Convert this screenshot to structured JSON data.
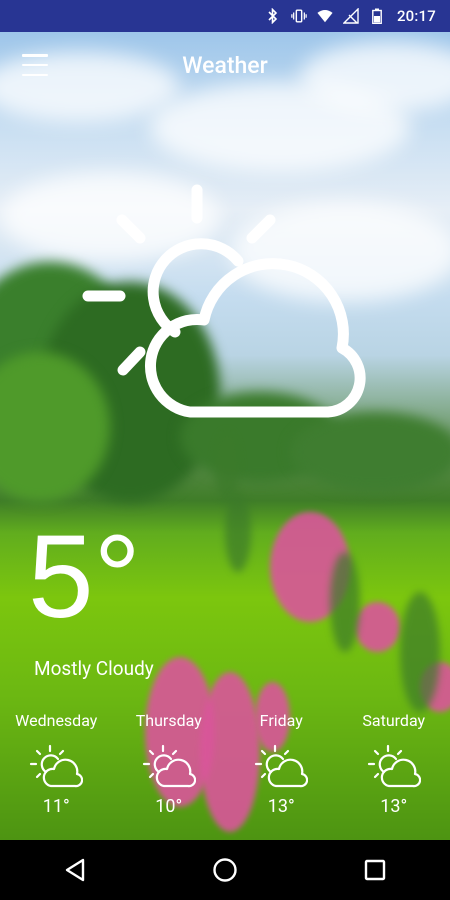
{
  "status_bar": {
    "time": "20:17",
    "icons": [
      "bluetooth-icon",
      "vibrate-icon",
      "wifi-icon",
      "no-signal-icon",
      "battery-icon"
    ]
  },
  "app_bar": {
    "title": "Weather",
    "menu_icon": "hamburger-menu-icon"
  },
  "current": {
    "temperature": "5°",
    "condition": "Mostly Cloudy",
    "icon": "partly-cloudy-icon"
  },
  "forecast": [
    {
      "day": "Wednesday",
      "temp": "11°",
      "icon": "partly-cloudy-icon"
    },
    {
      "day": "Thursday",
      "temp": "10°",
      "icon": "partly-cloudy-icon"
    },
    {
      "day": "Friday",
      "temp": "13°",
      "icon": "partly-cloudy-icon"
    },
    {
      "day": "Saturday",
      "temp": "13°",
      "icon": "partly-cloudy-icon"
    }
  ],
  "nav_bar": {
    "buttons": [
      "back-icon",
      "home-icon",
      "recents-icon"
    ]
  },
  "colors": {
    "status_bar": "#283593",
    "text": "#ffffff",
    "nav_bar": "#000000"
  }
}
